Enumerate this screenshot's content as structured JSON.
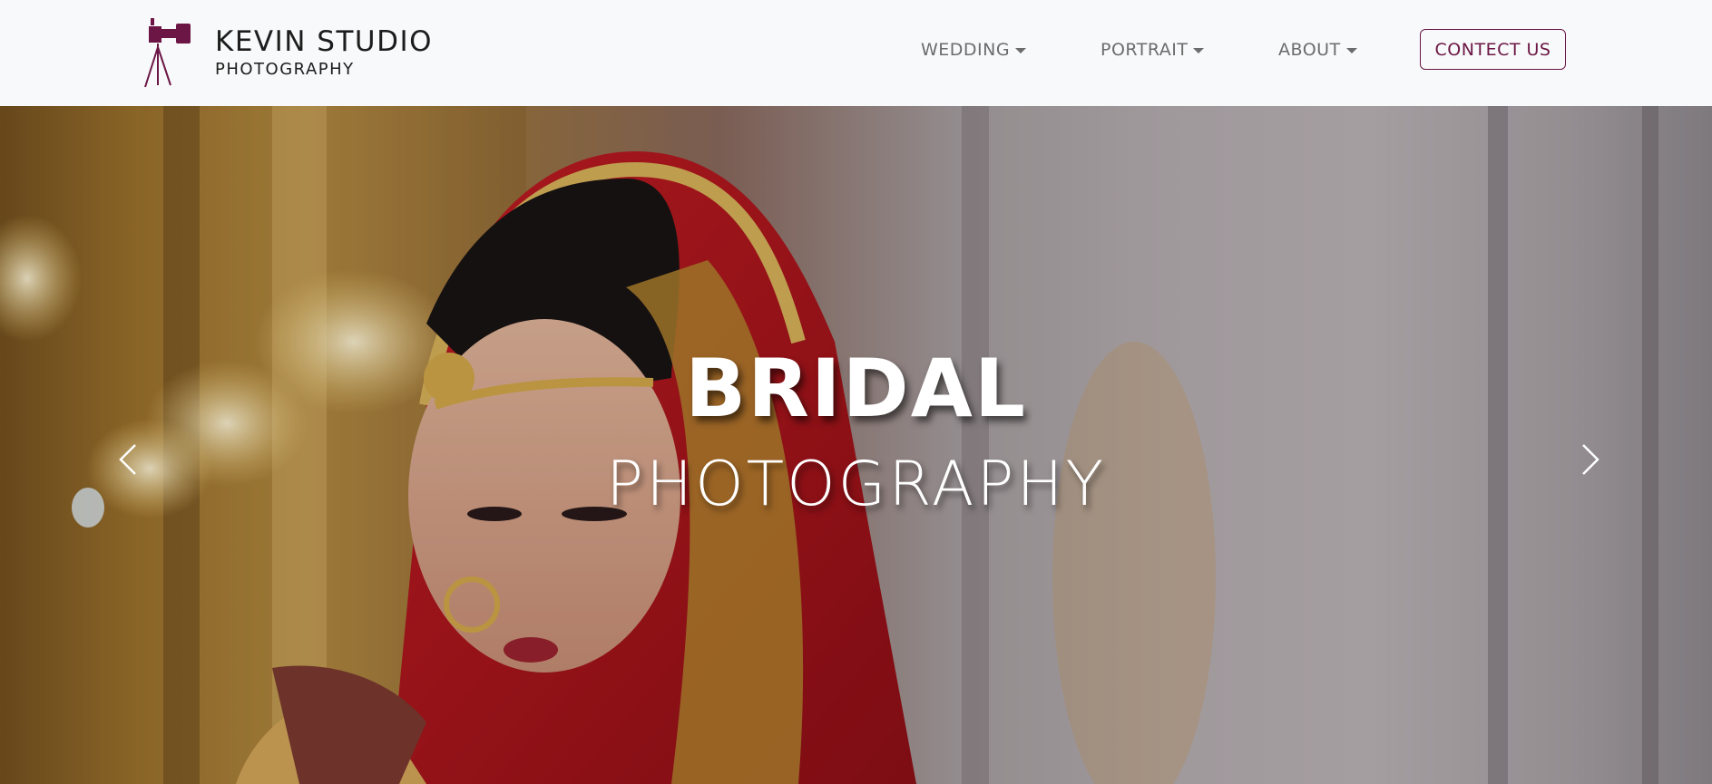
{
  "brand": {
    "title": "KEVIN STUDIO",
    "subtitle": "PHOTOGRAPHY",
    "logo_icon": "camera-tripod-icon",
    "accent_color": "#6b1644"
  },
  "nav": {
    "items": [
      {
        "label": "WEDDING",
        "icon": "caret-down-icon"
      },
      {
        "label": "PORTRAIT",
        "icon": "caret-down-icon"
      },
      {
        "label": "ABOUT",
        "icon": "caret-down-icon"
      }
    ],
    "contact_label": "CONTECT US"
  },
  "hero": {
    "title": "BRIDAL",
    "subtitle": "PHOTOGRAPHY",
    "prev_icon": "chevron-left-icon",
    "next_icon": "chevron-right-icon"
  }
}
